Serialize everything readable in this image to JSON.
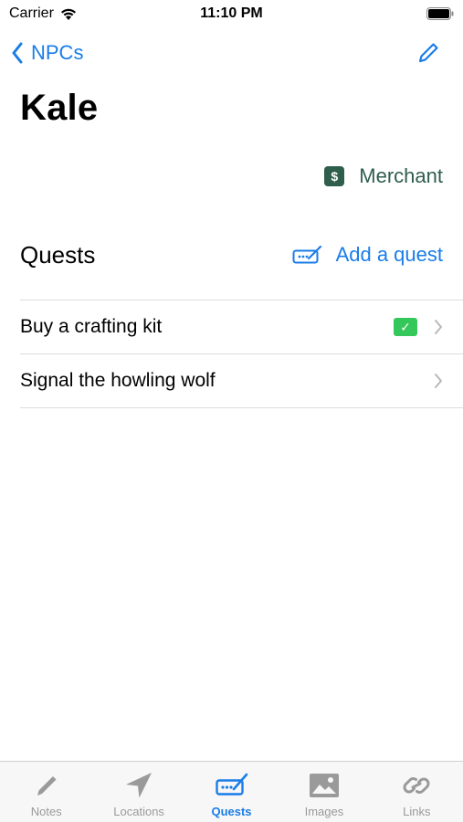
{
  "status_bar": {
    "carrier": "Carrier",
    "time": "11:10 PM"
  },
  "nav": {
    "back_label": "NPCs",
    "edit_icon": "pencil-icon"
  },
  "npc": {
    "name": "Kale",
    "role": "Merchant",
    "role_icon_glyph": "$"
  },
  "quests_section": {
    "title": "Quests",
    "add_label": "Add a quest",
    "items": [
      {
        "label": "Buy a crafting kit",
        "completed": true
      },
      {
        "label": "Signal the howling wolf",
        "completed": false
      }
    ]
  },
  "tab_bar": {
    "tabs": [
      {
        "label": "Notes",
        "icon": "pencil-icon",
        "active": false
      },
      {
        "label": "Locations",
        "icon": "location-arrow-icon",
        "active": false
      },
      {
        "label": "Quests",
        "icon": "quest-scroll-icon",
        "active": true
      },
      {
        "label": "Images",
        "icon": "photo-icon",
        "active": false
      },
      {
        "label": "Links",
        "icon": "link-icon",
        "active": false
      }
    ]
  },
  "colors": {
    "accent": "#1a7de8",
    "role": "#2f5e4c",
    "done": "#34c759"
  }
}
